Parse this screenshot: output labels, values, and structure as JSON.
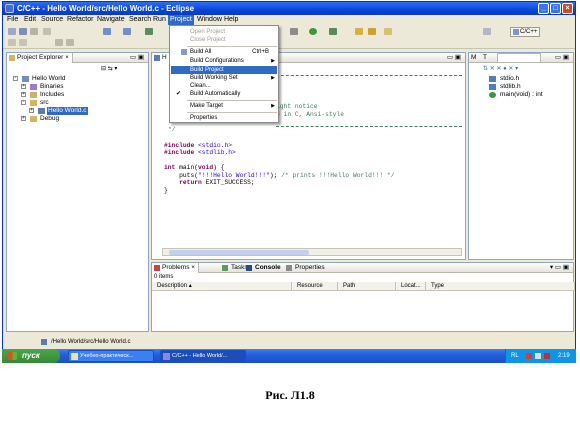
{
  "window": {
    "title": "C/C++ - Hello World/src/Hello World.c - Eclipse",
    "min": "_",
    "max": "□",
    "close": "×"
  },
  "menubar": [
    "File",
    "Edit",
    "Source",
    "Refactor",
    "Navigate",
    "Search",
    "Run",
    "Project",
    "Window",
    "Help"
  ],
  "perspective": "C/C++",
  "project_menu": {
    "items": [
      {
        "label": "Open Project",
        "disabled": true
      },
      {
        "label": "Close Project",
        "disabled": true
      },
      {
        "label": "Build All",
        "accel": "Ctrl+B"
      },
      {
        "label": "Build Configurations",
        "submenu": true
      },
      {
        "label": "Build Project",
        "highlighted": true
      },
      {
        "label": "Build Working Set",
        "submenu": true
      },
      {
        "label": "Clean..."
      },
      {
        "label": "Build Automatically",
        "checked": true
      },
      {
        "label": "Make Target",
        "submenu": true
      },
      {
        "label": "Properties"
      }
    ]
  },
  "project_explorer": {
    "tab": "Project Explorer",
    "tree": {
      "root": "Hello World",
      "binaries": "Binaries",
      "includes": "Includes",
      "src": "src",
      "file": "Hello World.c",
      "debug": "Debug"
    }
  },
  "editor": {
    "tab": "H",
    "lines": {
      "l1": "ight notice",
      "l2": "d in C, Ansi-style",
      "l3": "*/",
      "l4_kw": "#include",
      "l4_inc": "<stdio.h>",
      "l5_kw": "#include",
      "l5_inc": "<stdlib.h>",
      "l6_kw1": "int",
      "l6_mid": "main(",
      "l6_kw2": "void",
      "l6_end": ") {",
      "l7_a": "    puts(",
      "l7_str": "\"!!!Hello World!!!\"",
      "l7_b": "); ",
      "l7_cm": "/* prints !!!Hello World!!! */",
      "l8_kw": "    return",
      "l8_rest": " EXIT_SUCCESS;",
      "l9": "}"
    }
  },
  "outline": {
    "tabs": [
      "M",
      "T"
    ],
    "items": [
      "stdio.h",
      "stdlib.h",
      "main(void) : int"
    ]
  },
  "bottom": {
    "tabs": [
      "Problems",
      "Tasks",
      "Console",
      "Properties"
    ],
    "count": "0 items",
    "columns": [
      "Description",
      "Resource",
      "Path",
      "Locat...",
      "Type"
    ]
  },
  "status": {
    "path": "/Hello World/src/Hello World.c"
  },
  "taskbar": {
    "start": "пуск",
    "tasks": [
      "Учебно-практическ...",
      "C/C++ - Hello World/..."
    ],
    "lang": "RL",
    "time": "2:19"
  },
  "caption": "Рис. Л1.8"
}
